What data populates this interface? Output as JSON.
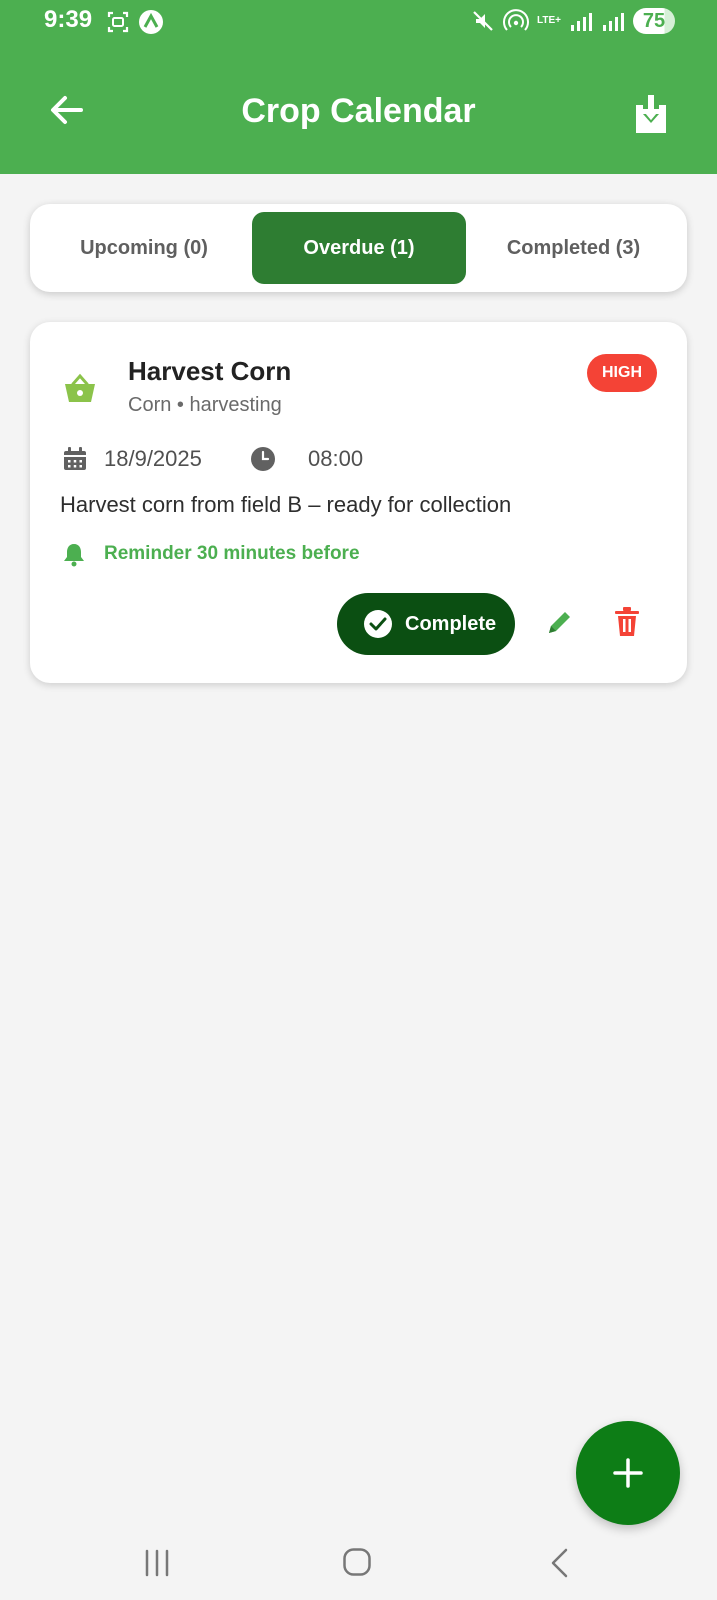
{
  "status_bar": {
    "time": "9:39",
    "network_label": "LTE+",
    "battery_level": "75",
    "icons": [
      "screenshot-icon",
      "navigation-app-icon",
      "mute-icon",
      "hotspot-icon",
      "signal-icon",
      "signal-icon",
      "battery-icon"
    ]
  },
  "header": {
    "title": "Crop Calendar",
    "back_icon": "arrow-left-icon",
    "download_icon": "download-icon"
  },
  "tabs": [
    {
      "label": "Upcoming (0)",
      "active": false
    },
    {
      "label": "Overdue (1)",
      "active": true
    },
    {
      "label": "Completed (3)",
      "active": false
    }
  ],
  "tasks": [
    {
      "title": "Harvest Corn",
      "subtitle": "Corn • harvesting",
      "priority": "HIGH",
      "date": "18/9/2025",
      "time": "08:00",
      "description": "Harvest corn from field B – ready for collection",
      "reminder": "Reminder 30 minutes before",
      "complete_label": "Complete"
    }
  ],
  "fab": {
    "icon": "plus-icon"
  },
  "nav": {
    "icons": [
      "recent-apps-icon",
      "home-icon",
      "back-icon"
    ]
  },
  "colors": {
    "header": "#4caf50",
    "tab_active": "#2e7d32",
    "priority_high": "#f44336",
    "complete_button": "#0b4f12",
    "fab": "#0d7d16",
    "reminder": "#4caf50"
  }
}
